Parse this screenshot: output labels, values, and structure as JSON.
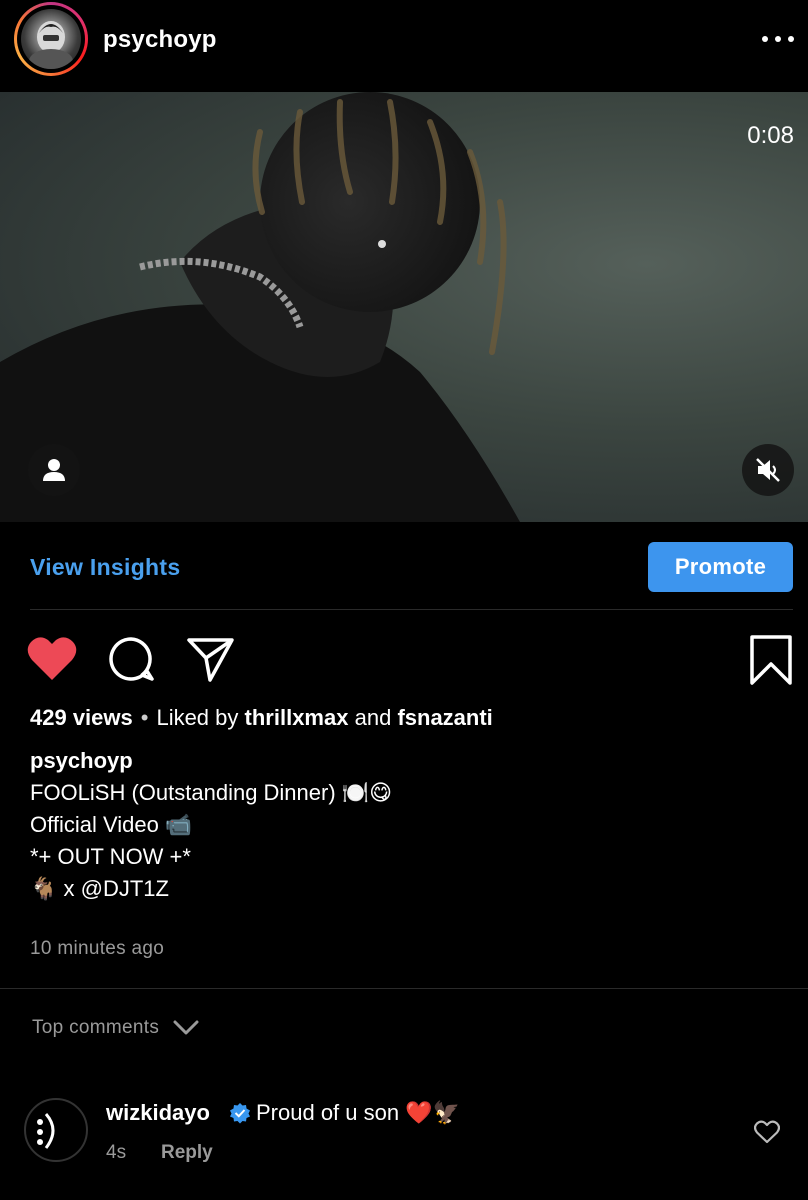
{
  "header": {
    "username": "psychoyp"
  },
  "video": {
    "timer": "0:08"
  },
  "insights": {
    "view_insights_label": "View Insights",
    "promote_label": "Promote"
  },
  "post": {
    "views": "429 views",
    "liked_by_prefix": "Liked by",
    "liked_user_1": "thrillxmax",
    "and_text": "and",
    "liked_user_2": "fsnazanti",
    "caption_user": "psychoyp",
    "caption_lines": [
      "FOOLiSH (Outstanding Dinner) 🍽️😋",
      "Official Video 📹",
      "*+ OUT NOW +*",
      "🐐 x @DJT1Z"
    ],
    "timestamp": "10 minutes ago"
  },
  "comments": {
    "section_label": "Top comments",
    "items": [
      {
        "username": "wizkidayo",
        "text": "Proud of u son ❤️🦅",
        "time": "4s",
        "reply_label": "Reply"
      }
    ]
  },
  "colors": {
    "link_blue": "#4aa0ee",
    "promote_blue": "#3d95ee",
    "like_red": "#ed4956",
    "muted_text": "#9a9a9a"
  },
  "icons": [
    "more-icon",
    "user-tag-icon",
    "mute-icon",
    "heart-icon",
    "comment-icon",
    "share-icon",
    "bookmark-icon",
    "chevron-down-icon",
    "verified-icon",
    "comment-like-icon"
  ]
}
